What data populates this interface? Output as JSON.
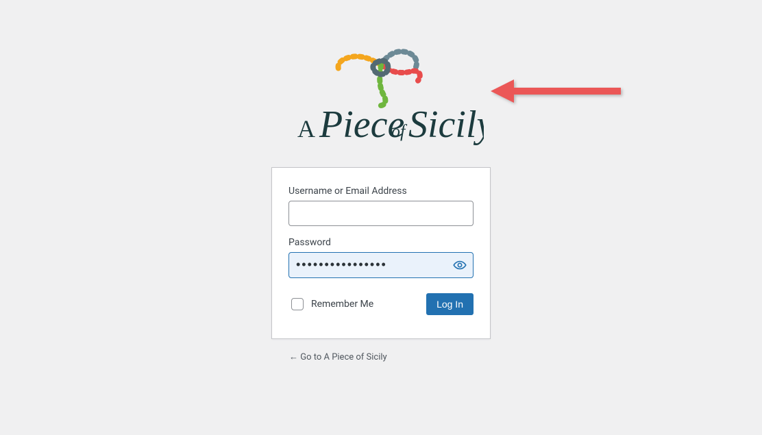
{
  "logo": {
    "alt": "A Piece of Sicily",
    "text_a": "A",
    "text_piece": "Piece",
    "text_of": "of",
    "text_sicily": "Sicily"
  },
  "form": {
    "username_label": "Username or Email Address",
    "username_value": "",
    "password_label": "Password",
    "password_value": "••••••••••••••••",
    "remember_label": "Remember Me",
    "submit_label": "Log In"
  },
  "nav": {
    "back_text": "← Go to A Piece of Sicily"
  },
  "colors": {
    "accent": "#2271b1",
    "arrow": "#eb5757"
  }
}
